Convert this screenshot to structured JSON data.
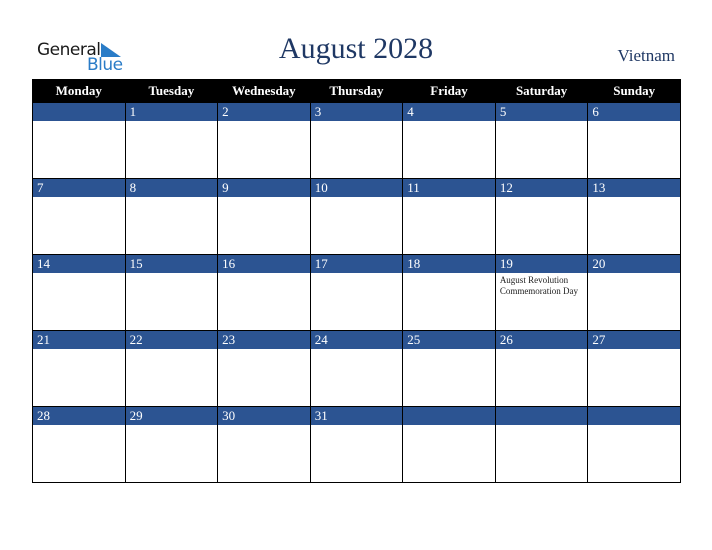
{
  "logo": {
    "word1": "General",
    "word2": "Blue",
    "icon": "triangle-flag-icon"
  },
  "title": "August 2028",
  "country": "Vietnam",
  "colors": {
    "header_bg": "#000000",
    "day_bar": "#2c5492",
    "title": "#1f3864",
    "logo_blue": "#2a7cc7"
  },
  "weekdays": [
    "Monday",
    "Tuesday",
    "Wednesday",
    "Thursday",
    "Friday",
    "Saturday",
    "Sunday"
  ],
  "weeks": [
    [
      {
        "day": ""
      },
      {
        "day": "1"
      },
      {
        "day": "2"
      },
      {
        "day": "3"
      },
      {
        "day": "4"
      },
      {
        "day": "5"
      },
      {
        "day": "6"
      }
    ],
    [
      {
        "day": "7"
      },
      {
        "day": "8"
      },
      {
        "day": "9"
      },
      {
        "day": "10"
      },
      {
        "day": "11"
      },
      {
        "day": "12"
      },
      {
        "day": "13"
      }
    ],
    [
      {
        "day": "14"
      },
      {
        "day": "15"
      },
      {
        "day": "16"
      },
      {
        "day": "17"
      },
      {
        "day": "18"
      },
      {
        "day": "19",
        "holiday": "August Revolution Commemoration Day"
      },
      {
        "day": "20"
      }
    ],
    [
      {
        "day": "21"
      },
      {
        "day": "22"
      },
      {
        "day": "23"
      },
      {
        "day": "24"
      },
      {
        "day": "25"
      },
      {
        "day": "26"
      },
      {
        "day": "27"
      }
    ],
    [
      {
        "day": "28"
      },
      {
        "day": "29"
      },
      {
        "day": "30"
      },
      {
        "day": "31"
      },
      {
        "day": ""
      },
      {
        "day": ""
      },
      {
        "day": ""
      }
    ]
  ]
}
